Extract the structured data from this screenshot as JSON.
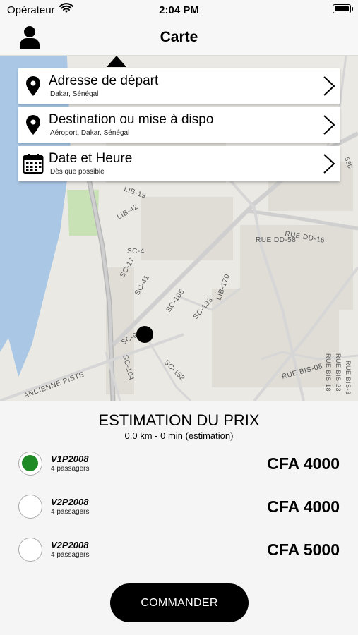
{
  "status_bar": {
    "carrier": "Opérateur",
    "time": "2:04 PM"
  },
  "nav": {
    "title": "Carte",
    "icon": "user-icon"
  },
  "map": {
    "labels": {
      "lib19": "LIB-19",
      "lib42": "LIB-42",
      "sc4": "SC-4",
      "sc17": "SC-17",
      "sc41": "SC-41",
      "sc105": "SC-105",
      "sc133": "SC-133",
      "lib170": "LIB-170",
      "sc9": "SC-9",
      "sc104": "SC-104",
      "sc152": "SC-152",
      "ruedd16": "RUE DD-16",
      "ruedd58": "RUE DD-58",
      "ruebis08": "RUE BIS-08",
      "ruebis1": "RUE BIS-18",
      "ruebis2": "RUE BIS-23",
      "ruebis3": "RUE BIS-3",
      "piste": "ANCIENNE PISTE",
      "l538": "538"
    }
  },
  "cards": {
    "depart": {
      "title": "Adresse de départ",
      "subtitle": "Dakar, Sénégal",
      "icon": "map-pin-icon"
    },
    "destination": {
      "title": "Destination ou mise à dispo",
      "subtitle": "Aéroport, Dakar, Sénégal",
      "icon": "map-pin-icon"
    },
    "date": {
      "title": "Date et Heure",
      "subtitle": "Dès que possible",
      "icon": "calendar-icon"
    }
  },
  "estimation": {
    "title": "ESTIMATION DU PRIX",
    "distance_time": "0.0 km - 0 min",
    "link": "(estimation)"
  },
  "options": [
    {
      "name": "V1P2008",
      "passengers": "4 passagers",
      "price": "CFA 4000",
      "selected": true
    },
    {
      "name": "V2P2008",
      "passengers": "4 passagers",
      "price": "CFA 4000",
      "selected": false
    },
    {
      "name": "V2P2008",
      "passengers": "4 passagers",
      "price": "CFA 5000",
      "selected": false
    }
  ],
  "order_button": "COMMANDER",
  "colors": {
    "selected": "#1e8a23",
    "button": "#000000"
  }
}
